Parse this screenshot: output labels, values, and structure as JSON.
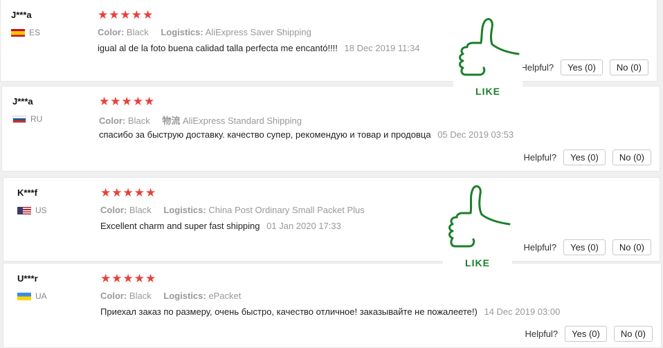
{
  "reviews": [
    {
      "user": "J***a",
      "country_code": "ES",
      "flag": "spain-flag",
      "stars": "★★★★★",
      "rating": 5,
      "color_label": "Color:",
      "color_value": "Black",
      "logistics_label": "Logistics:",
      "logistics_value": "AliExpress Saver Shipping",
      "text": "igual al de la foto buena calidad talla perfecta me encantó!!!!",
      "date": "18 Dec 2019 11:34",
      "helpful_label": "Helpful?",
      "yes_label": "Yes (0)",
      "no_label": "No (0)"
    },
    {
      "user": "J***a",
      "country_code": "RU",
      "flag": "russia-flag",
      "stars": "★★★★★",
      "rating": 5,
      "color_label": "Color:",
      "color_value": "Black",
      "logistics_label": "物流",
      "logistics_value": "AliExpress Standard Shipping",
      "text": "спасибо за быструю доставку. качество супер, рекомендую и товар и продовца",
      "date": "05 Dec 2019 03:53",
      "helpful_label": "Helpful?",
      "yes_label": "Yes (0)",
      "no_label": "No (0)"
    },
    {
      "user": "K***f",
      "country_code": "US",
      "flag": "usa-flag",
      "stars": "★★★★★",
      "rating": 5,
      "color_label": "Color:",
      "color_value": "Black",
      "logistics_label": "Logistics:",
      "logistics_value": "China Post Ordinary Small Packet Plus",
      "text": "Excellent charm and super fast shipping",
      "date": "01 Jan 2020 17:33",
      "helpful_label": "Helpful?",
      "yes_label": "Yes (0)",
      "no_label": "No (0)"
    },
    {
      "user": "U***r",
      "country_code": "UA",
      "flag": "ukraine-flag",
      "stars": "★★★★★",
      "rating": 5,
      "color_label": "Color:",
      "color_value": "Black",
      "logistics_label": "Logistics:",
      "logistics_value": "ePacket",
      "text": "Приехал заказ по размеру, очень быстро, качество отличное! заказывайте не пожалеете!)",
      "date": "14 Dec 2019 03:00",
      "helpful_label": "Helpful?",
      "yes_label": "Yes (0)",
      "no_label": "No (0)"
    }
  ],
  "overlays": [
    {
      "label": "LIKE",
      "icon": "thumbs-up-icon"
    },
    {
      "label": "LIKE",
      "icon": "thumbs-up-icon"
    }
  ],
  "colors": {
    "star": "#e8403a",
    "thumb": "#1a7f2a",
    "muted": "#999999"
  }
}
